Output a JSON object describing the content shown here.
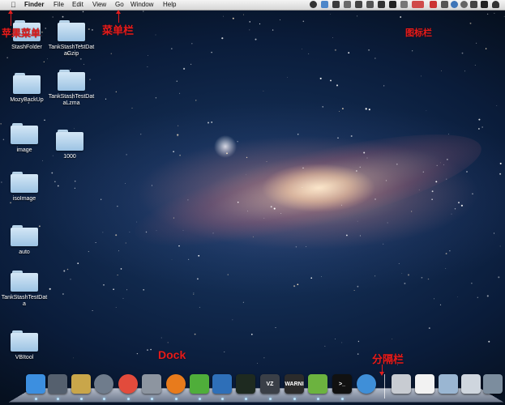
{
  "menubar": {
    "apple_icon": "apple-icon",
    "app_name": "Finder",
    "menus": [
      "File",
      "Edit",
      "View",
      "Go",
      "Window",
      "Help"
    ]
  },
  "desktop": {
    "icons": [
      {
        "label": "StashFolder"
      },
      {
        "label": "TankStashTestDataGzip"
      },
      {
        "label": "MozyBackUp"
      },
      {
        "label": "TankStashTestDataLzma"
      },
      {
        "label": "image"
      },
      {
        "label": "1000"
      },
      {
        "label": "isoImage"
      },
      {
        "label": "auto"
      },
      {
        "label": "TankStashTestData"
      },
      {
        "label": "VBItool"
      }
    ]
  },
  "annotations": {
    "apple_menu": "苹果菜单",
    "menu_bar": "菜单栏",
    "status_bar": "图标栏",
    "dock": "Dock",
    "separator": "分隔栏"
  },
  "dock": {
    "apps": [
      {
        "name": "finder-icon",
        "color": "#3c8fe0"
      },
      {
        "name": "dashboard-icon",
        "color": "#55606e"
      },
      {
        "name": "keychain-icon",
        "color": "#c9a64a"
      },
      {
        "name": "rocket-icon",
        "color": "#6f7c8c"
      },
      {
        "name": "chrome-icon",
        "color": "#e24b3c"
      },
      {
        "name": "system-preferences-icon",
        "color": "#8d95a0"
      },
      {
        "name": "firefox-icon",
        "color": "#e87b1c"
      },
      {
        "name": "adium-icon",
        "color": "#4fae3a"
      },
      {
        "name": "virtualbox-icon",
        "color": "#2e6fb8"
      },
      {
        "name": "terminal-green-icon",
        "color": "#1e2a20"
      },
      {
        "name": "vz-icon",
        "color": "#3a3f47"
      },
      {
        "name": "console-icon",
        "color": "#2b2b2b"
      },
      {
        "name": "evernote-icon",
        "color": "#6cb33f"
      },
      {
        "name": "terminal-icon",
        "color": "#111111"
      },
      {
        "name": "safari-icon",
        "color": "#3f8fd8"
      }
    ],
    "docs": [
      {
        "name": "printer-icon",
        "color": "#c8ccd2"
      },
      {
        "name": "document-icon",
        "color": "#f2f2f2"
      },
      {
        "name": "stack-folder-icon",
        "color": "#9ab6d2"
      },
      {
        "name": "screenshot-stack-icon",
        "color": "#cfd6de"
      },
      {
        "name": "downloads-stack-icon",
        "color": "#7c8d9e"
      },
      {
        "name": "trash-icon",
        "color": "#c0c6cc"
      }
    ],
    "labels": {
      "vz": "VZ",
      "console": "WARNI",
      "terminal": ">_"
    }
  }
}
